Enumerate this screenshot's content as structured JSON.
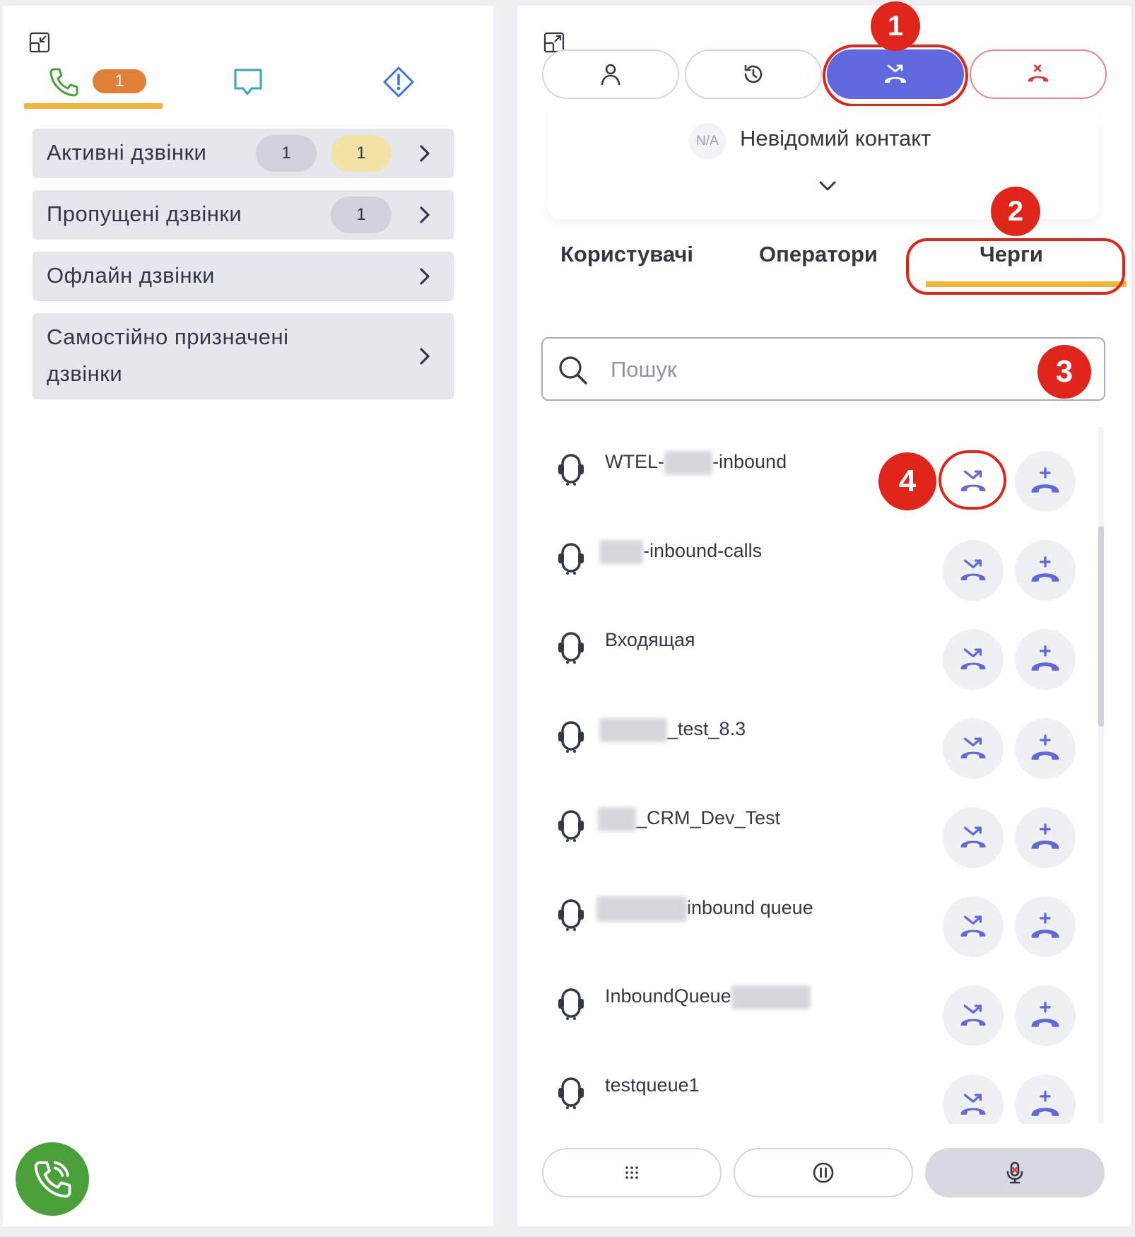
{
  "left": {
    "tabs": [
      {
        "icon": "phone-icon",
        "badge": "1"
      },
      {
        "icon": "chat-icon"
      },
      {
        "icon": "warning-icon"
      }
    ],
    "call_groups": [
      {
        "label": "Активні дзвінки",
        "badges": [
          "1",
          "1"
        ]
      },
      {
        "label": "Пропущені дзвінки",
        "badges": [
          "1"
        ]
      },
      {
        "label": "Офлайн дзвінки",
        "badges": []
      },
      {
        "label": "Самостійно призначені дзвінки",
        "line1": "Самостійно призначені",
        "line2": "дзвінки",
        "badges": []
      }
    ]
  },
  "right": {
    "top_buttons": [
      {
        "icon": "person-icon"
      },
      {
        "icon": "history-icon"
      },
      {
        "icon": "transfer-call-icon",
        "active": true
      },
      {
        "icon": "hangup-icon"
      }
    ],
    "contact": {
      "avatar": "N/A",
      "name": "Невідомий контакт"
    },
    "peer_tabs": [
      "Користувачі",
      "Оператори",
      "Черги"
    ],
    "selected_peer_tab": "Черги",
    "search": {
      "placeholder": "Пошук",
      "value": ""
    },
    "queues": [
      {
        "prefix": "WTEL-",
        "suffix": "-inbound"
      },
      {
        "prefix": "",
        "suffix": "-inbound-calls"
      },
      {
        "prefix": "Входящая",
        "suffix": ""
      },
      {
        "prefix": "",
        "suffix": "_test_8.3"
      },
      {
        "prefix": "",
        "suffix": "_CRM_Dev_Test"
      },
      {
        "prefix": "",
        "suffix": "inbound queue"
      },
      {
        "prefix": "InboundQueue",
        "suffix": ""
      },
      {
        "prefix": "testqueue1",
        "suffix": ""
      }
    ],
    "bottom_buttons": [
      {
        "icon": "dialpad-icon"
      },
      {
        "icon": "pause-icon"
      },
      {
        "icon": "mute-mic-icon"
      }
    ]
  },
  "annotations": [
    "1",
    "2",
    "3",
    "4"
  ],
  "colors": {
    "accent": "#5f68dc",
    "tab_underline": "#f0b63a",
    "annotation": "#e0261a",
    "call_green": "#4aa038",
    "badge_orange": "#e07f38"
  }
}
